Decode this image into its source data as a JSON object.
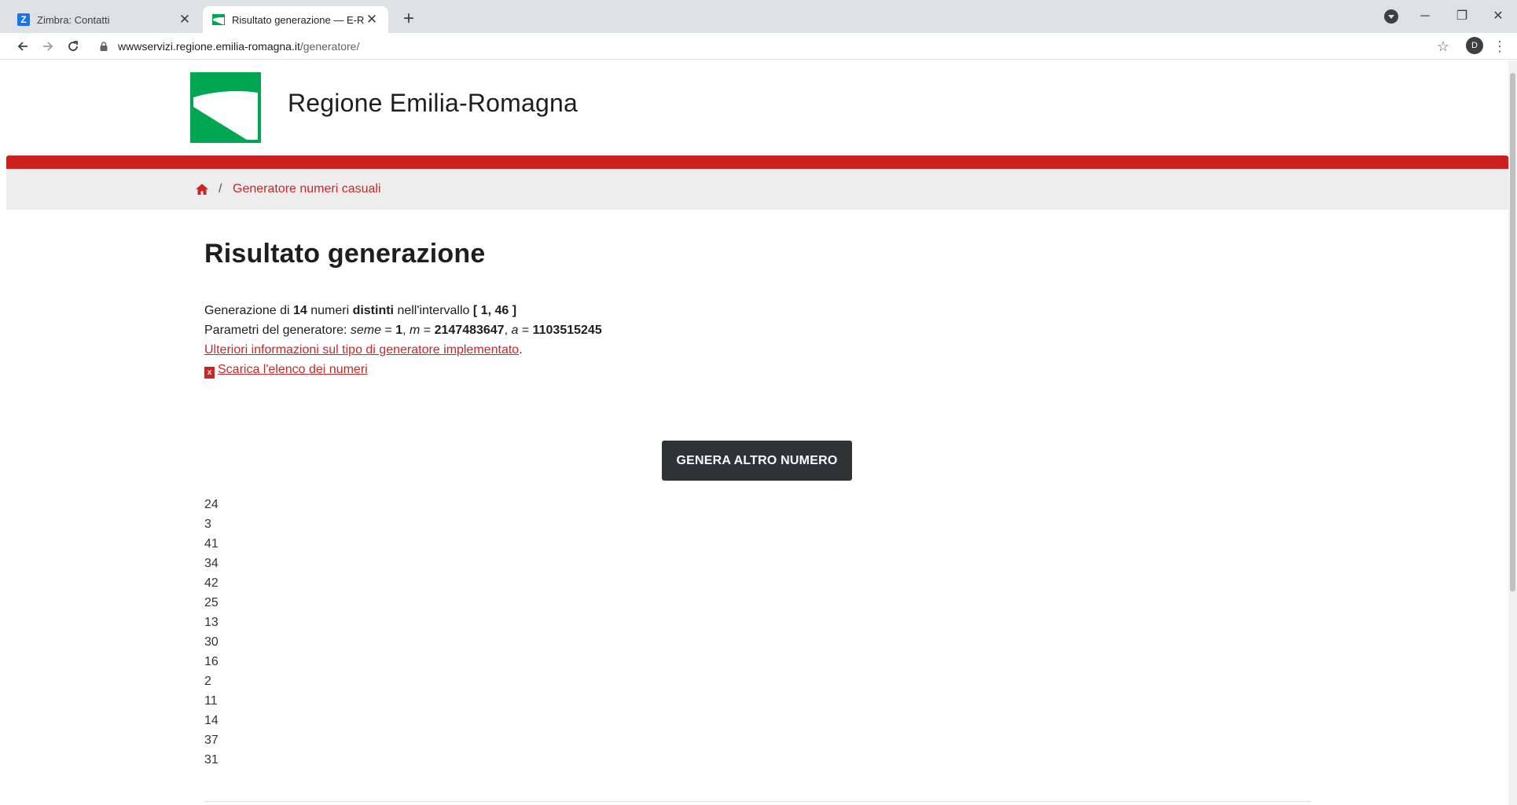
{
  "browser": {
    "tabs": [
      {
        "title": "Zimbra: Contatti",
        "favicon_letter": "Z"
      },
      {
        "title": "Risultato generazione — E-R Il p"
      }
    ],
    "close_glyph": "✕",
    "new_tab_glyph": "+",
    "url_domain": "wwwservizi.regione.emilia-romagna.it",
    "url_path": "/generatore/",
    "profile_initial": "D"
  },
  "site": {
    "name": "Regione Emilia-Romagna",
    "accent_color": "#cc1f1f",
    "logo_color": "#00a651"
  },
  "breadcrumb": {
    "separator": "/",
    "current": "Generatore numeri casuali"
  },
  "main": {
    "heading": "Risultato generazione",
    "line1": {
      "prefix": "Generazione di ",
      "count": "14",
      "mid": " numeri ",
      "distinct": "distinti",
      "interval_label": " nell'intervallo ",
      "interval": "[ 1, 46 ]"
    },
    "line2": {
      "prefix": "Parametri del generatore: ",
      "seme_label": "seme",
      "eq": " = ",
      "seme": "1",
      "sep": ", ",
      "m_label": "m",
      "m": "2147483647",
      "a_label": "a",
      "a": "1103515245"
    },
    "info_link": "Ulteriori informazioni sul tipo di generatore implementato",
    "info_link_suffix": ".",
    "download_link": "Scarica l'elenco dei numeri",
    "download_icon_glyph": "x",
    "generate_button": "GENERA ALTRO NUMERO",
    "numbers": [
      "24",
      "3",
      "41",
      "34",
      "42",
      "25",
      "13",
      "30",
      "16",
      "2",
      "11",
      "14",
      "37",
      "31"
    ]
  }
}
